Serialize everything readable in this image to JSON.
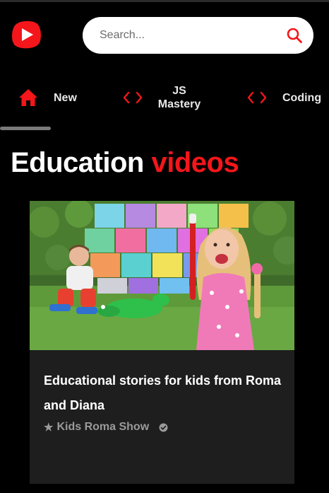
{
  "brand": {
    "logo_icon": "play-logo-icon",
    "accent_color": "#f4161a"
  },
  "search": {
    "placeholder": "Search...",
    "value": "",
    "icon": "search-icon"
  },
  "categories": [
    {
      "label": "New",
      "icon": "home-icon",
      "active": true
    },
    {
      "label": "JS Mastery",
      "icon": "code-icon",
      "active": false
    },
    {
      "label": "Coding",
      "icon": "code-icon",
      "active": false
    }
  ],
  "page": {
    "title_main": "Education",
    "title_accent": "videos"
  },
  "video": {
    "title": "Educational stories for kids from Roma and Diana",
    "channel": "Kids Roma Show",
    "star_glyph": "★",
    "verified_icon": "check-circle-icon"
  }
}
